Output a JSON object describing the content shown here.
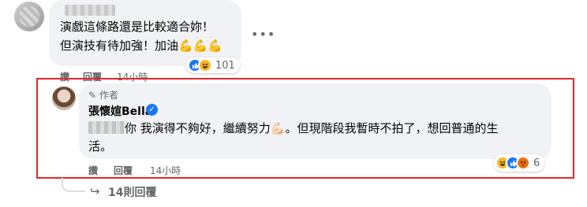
{
  "comment1": {
    "lines": [
      "演戲這條路還是比較適合妳！",
      "但演技有待加強！加油💪💪💪"
    ],
    "reaction_count": "101",
    "actions": {
      "like": "讚",
      "reply": "回覆",
      "time": "14小時"
    },
    "more": "•••"
  },
  "reply": {
    "badge": "✎ 作者",
    "author": "張懷媗Bella",
    "verified_mark": "✓",
    "line1": "你 我演得不夠好，繼續努力💪🏻。但現階段我暫時不拍了，想回普通的生",
    "line2": "活。",
    "reaction_count": "6",
    "actions": {
      "like": "讚",
      "reply": "回覆",
      "time": "14小時"
    }
  },
  "view_replies": {
    "arrow": "↪",
    "label": "14則回覆"
  },
  "icons": {
    "like": "like-icon",
    "haha": "haha-icon",
    "angry": "angry-icon"
  },
  "colors": {
    "highlight": "#e4262c",
    "bubble": "#f0f2f5",
    "like": "#1877f2"
  }
}
